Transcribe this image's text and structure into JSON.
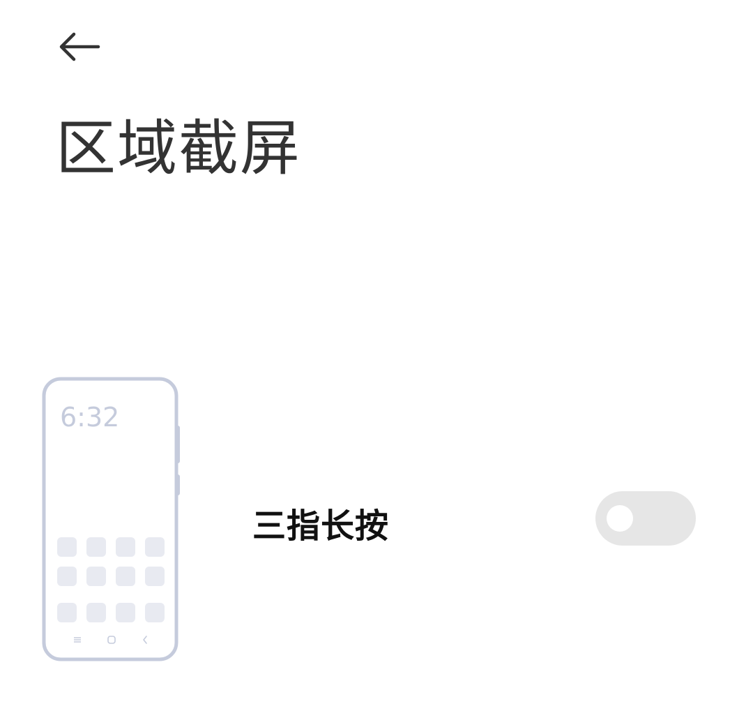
{
  "header": {
    "back_icon": "arrow-left-icon",
    "title": "区域截屏"
  },
  "setting": {
    "illustration": {
      "icon": "phone-illustration-icon",
      "time": "6:32",
      "outline_color": "#c5cbdc",
      "tile_color": "#e8eaf1"
    },
    "label": "三指长按",
    "toggle": {
      "on": false,
      "track_color": "#e6e6e6",
      "knob_color": "#ffffff"
    }
  }
}
